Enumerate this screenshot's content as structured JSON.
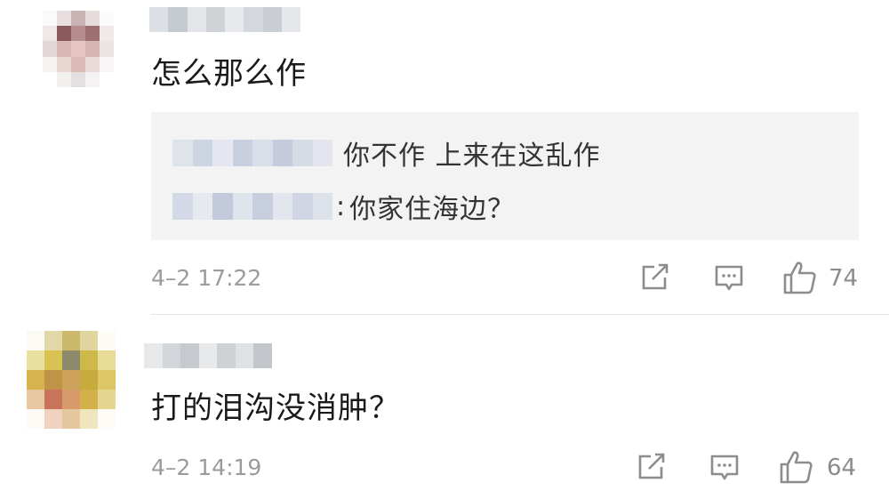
{
  "comments": [
    {
      "text": "怎么那么作",
      "time": "4–2 17:22",
      "likes": "74",
      "replies": [
        {
          "separator": "",
          "text": "你不作 上来在这乱作"
        },
        {
          "separator": ":",
          "text": "你家住海边？"
        }
      ]
    },
    {
      "text": "打的泪沟没消肿？",
      "time": "4–2 14:19",
      "likes": "64"
    }
  ],
  "icons": {
    "share": "share-icon",
    "reply": "comment-icon",
    "like": "thumbs-up-icon"
  },
  "colors": {
    "reply_background": "#f3f3f3",
    "meta_text": "#9b9b9b"
  }
}
